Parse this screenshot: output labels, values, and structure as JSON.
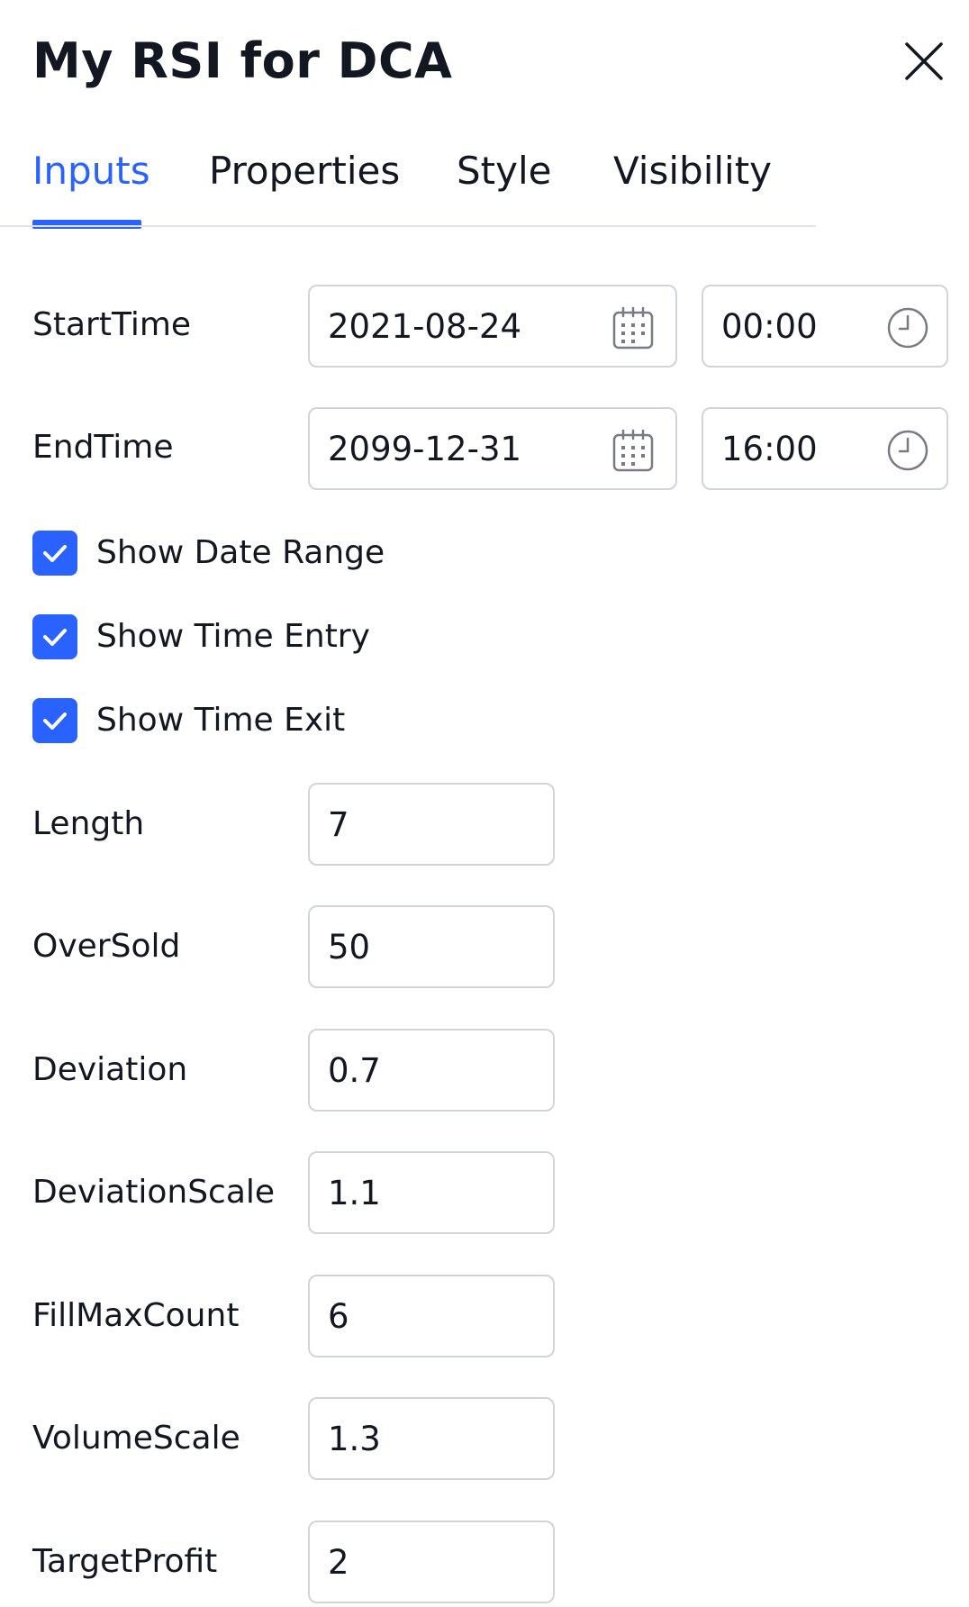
{
  "dialog": {
    "title": "My RSI for DCA"
  },
  "tabs": [
    {
      "label": "Inputs",
      "active": true
    },
    {
      "label": "Properties",
      "active": false
    },
    {
      "label": "Style",
      "active": false
    },
    {
      "label": "Visibility",
      "active": false
    }
  ],
  "inputs": {
    "start_time": {
      "label": "StartTime",
      "date": "2021-08-24",
      "time": "00:00"
    },
    "end_time": {
      "label": "EndTime",
      "date": "2099-12-31",
      "time": "16:00"
    },
    "checkboxes": [
      {
        "label": "Show Date Range",
        "checked": true
      },
      {
        "label": "Show Time Entry",
        "checked": true
      },
      {
        "label": "Show Time Exit",
        "checked": true
      }
    ],
    "length": {
      "label": "Length",
      "value": "7"
    },
    "oversold": {
      "label": "OverSold",
      "value": "50"
    },
    "deviation": {
      "label": "Deviation",
      "value": "0.7"
    },
    "deviation_scale": {
      "label": "DeviationScale",
      "value": "1.1"
    },
    "fill_max_count": {
      "label": "FillMaxCount",
      "value": "6"
    },
    "volume_scale": {
      "label": "VolumeScale",
      "value": "1.3"
    },
    "target_profit": {
      "label": "TargetProfit",
      "value": "2"
    }
  },
  "icons": {
    "close": "close-icon",
    "calendar": "calendar-icon",
    "clock": "clock-icon",
    "check": "checkmark-icon"
  },
  "colors": {
    "accent": "#2962ff",
    "text": "#131722",
    "border": "#d1d4dc",
    "icon": "#787b86"
  }
}
